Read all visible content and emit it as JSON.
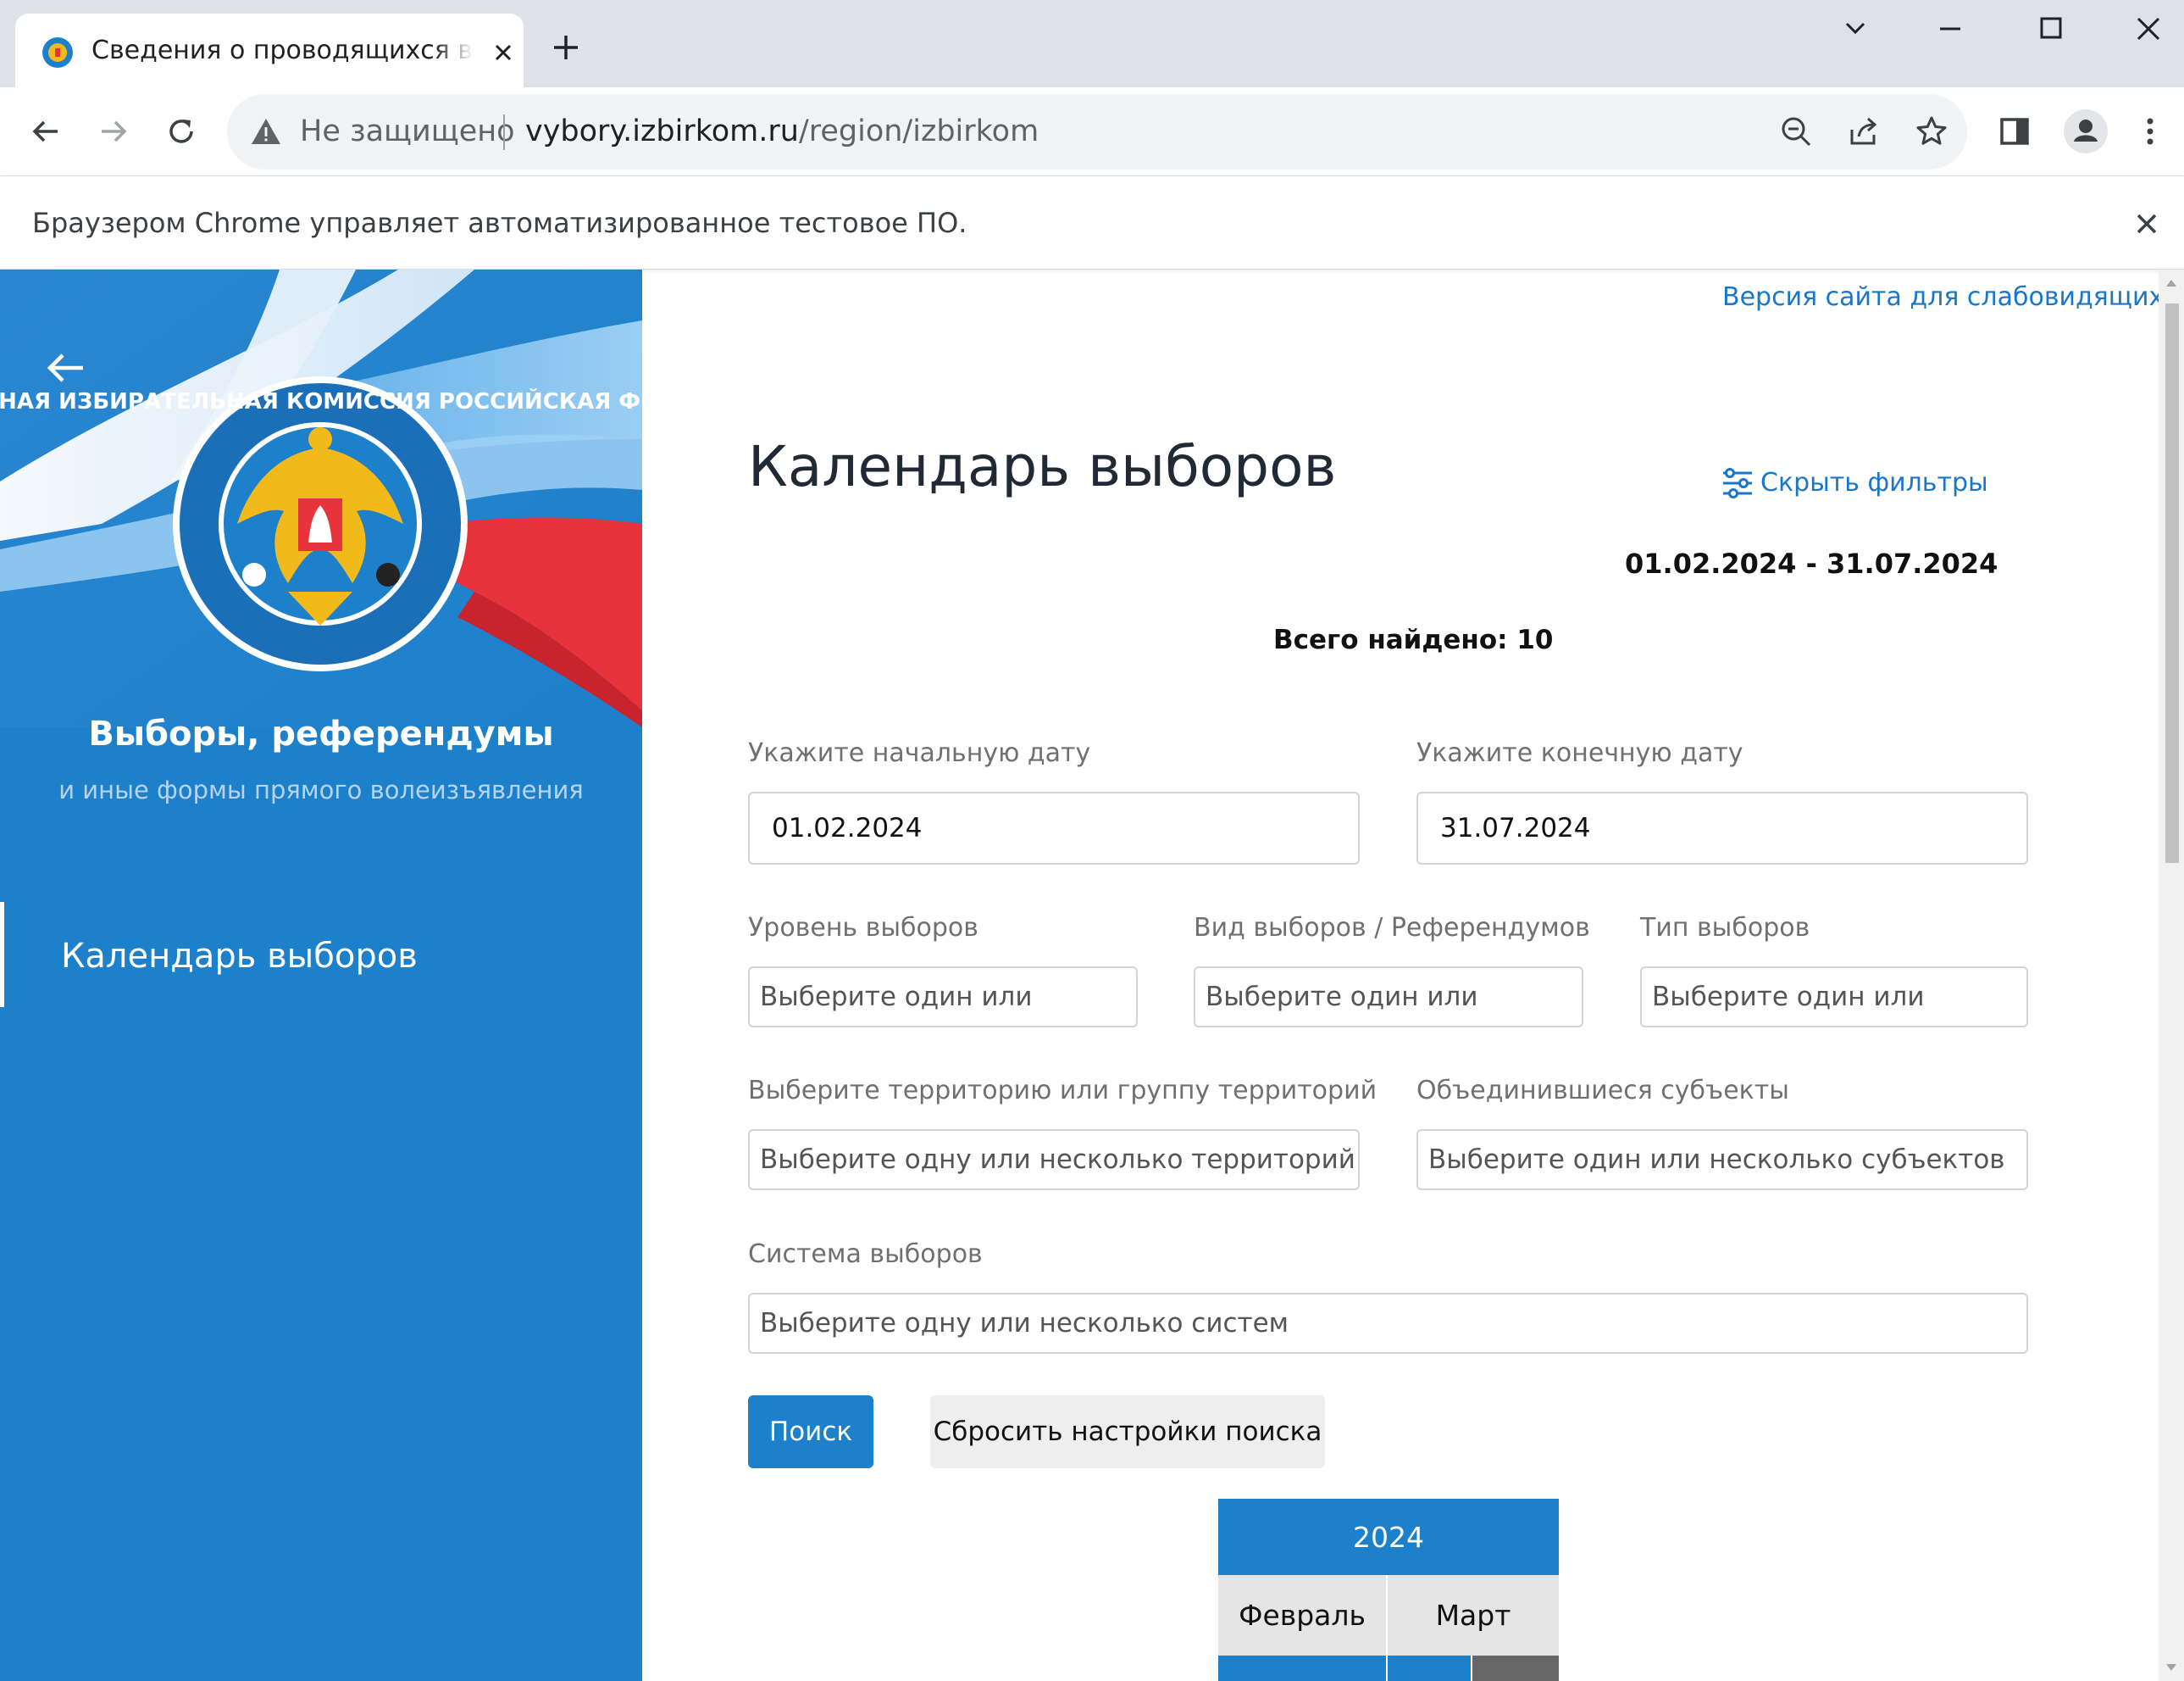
{
  "browser": {
    "tab_title": "Сведения о проводящихся выборах",
    "security_label": "Не защищено",
    "url_host": "vybory.izbirkom.ru",
    "url_path": "/region/izbirkom",
    "automation_notice": "Браузером Chrome управляет автоматизированное тестовое ПО."
  },
  "sidebar": {
    "emblem_ring_text": "ЦЕНТРАЛЬНАЯ ИЗБИРАТЕЛЬНАЯ КОМИССИЯ РОССИЙСКАЯ ФЕДЕРАЦИЯ",
    "title": "Выборы, референдумы",
    "subtitle": "и иные формы прямого волеизъявления",
    "nav_items": [
      {
        "label": "Календарь выборов",
        "active": true
      }
    ]
  },
  "main": {
    "accessibility_link": "Версия сайта для слабовидящих",
    "page_title": "Календарь выборов",
    "filter_toggle": "Скрыть фильтры",
    "date_range": "01.02.2024 - 31.07.2024",
    "total_found": "Всего найдено: 10",
    "filters": {
      "start_date_label": "Укажите начальную дату",
      "start_date_value": "01.02.2024",
      "end_date_label": "Укажите конечную дату",
      "end_date_value": "31.07.2024",
      "level_label": "Уровень выборов",
      "level_placeholder": "Выберите один или",
      "kind_label": "Вид выборов / Референдумов",
      "kind_placeholder": "Выберите один или",
      "type_label": "Тип выборов",
      "type_placeholder": "Выберите один или",
      "territory_label": "Выберите территорию или группу территорий",
      "territory_placeholder": "Выберите одну или несколько территорий",
      "subjects_label": "Объединившиеся субъекты",
      "subjects_placeholder": "Выберите один или несколько субъектов",
      "system_label": "Система выборов",
      "system_placeholder": "Выберите одну или несколько систем"
    },
    "search_button": "Поиск",
    "reset_button": "Сбросить настройки поиска",
    "calendar": {
      "year": "2024",
      "months": [
        "Февраль",
        "Март"
      ]
    }
  },
  "colors": {
    "brand_blue": "#1d80ca",
    "link_blue": "#1976c9",
    "flag_red": "#e8323c"
  },
  "icons": [
    "favicon-icon",
    "close-icon",
    "plus-icon",
    "chevron-down-icon",
    "minimize-icon",
    "maximize-icon",
    "back-arrow-icon",
    "forward-arrow-icon",
    "reload-icon",
    "warning-icon",
    "zoom-out-icon",
    "share-icon",
    "star-icon",
    "side-panel-icon",
    "profile-icon",
    "kebab-menu-icon",
    "sliders-icon"
  ]
}
